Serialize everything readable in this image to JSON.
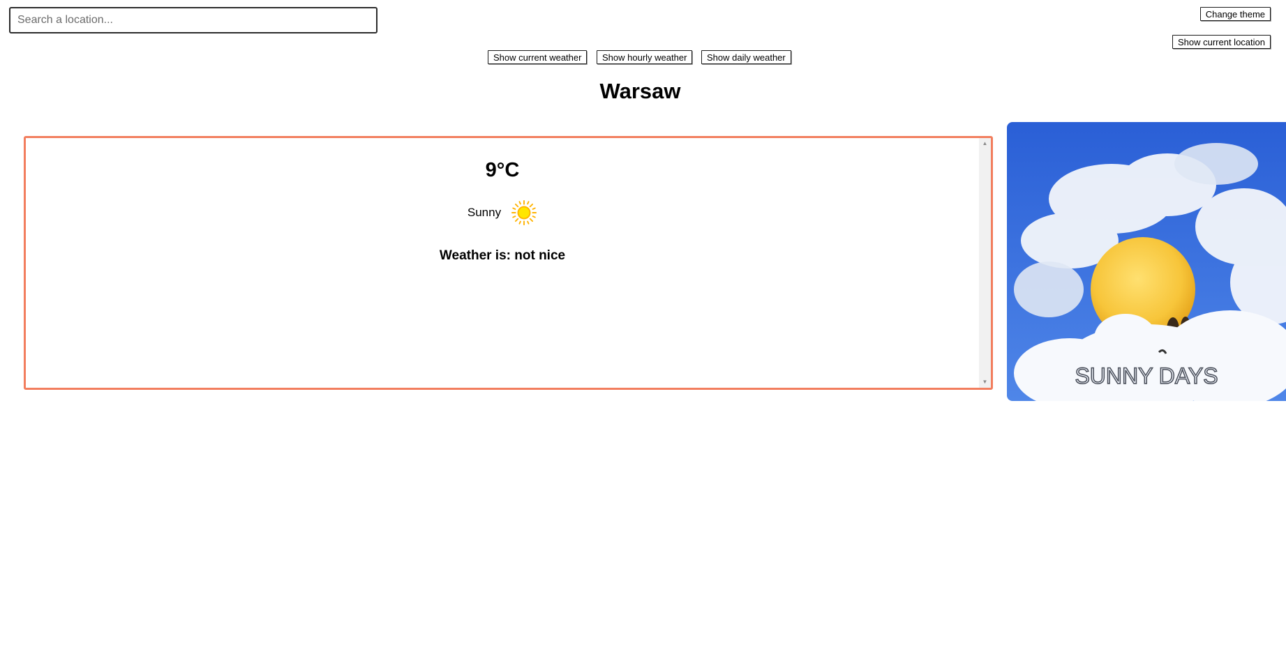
{
  "search": {
    "placeholder": "Search a location...",
    "value": ""
  },
  "header": {
    "change_theme_label": "Change theme",
    "show_location_label": "Show current location"
  },
  "view_switch": {
    "current_label": "Show current weather",
    "hourly_label": "Show hourly weather",
    "daily_label": "Show daily weather"
  },
  "location": {
    "name": "Warsaw"
  },
  "current_weather": {
    "temperature": "9°C",
    "condition": "Sunny",
    "condition_icon": "sun-icon",
    "verdict": "Weather is: not nice"
  },
  "image": {
    "caption": "SUNNY DAYS"
  },
  "colors": {
    "panel_border": "#f27e5e",
    "sun_fill": "#ffd400",
    "sun_rays": "#ffb300",
    "sky_blue": "#2f63d8"
  }
}
